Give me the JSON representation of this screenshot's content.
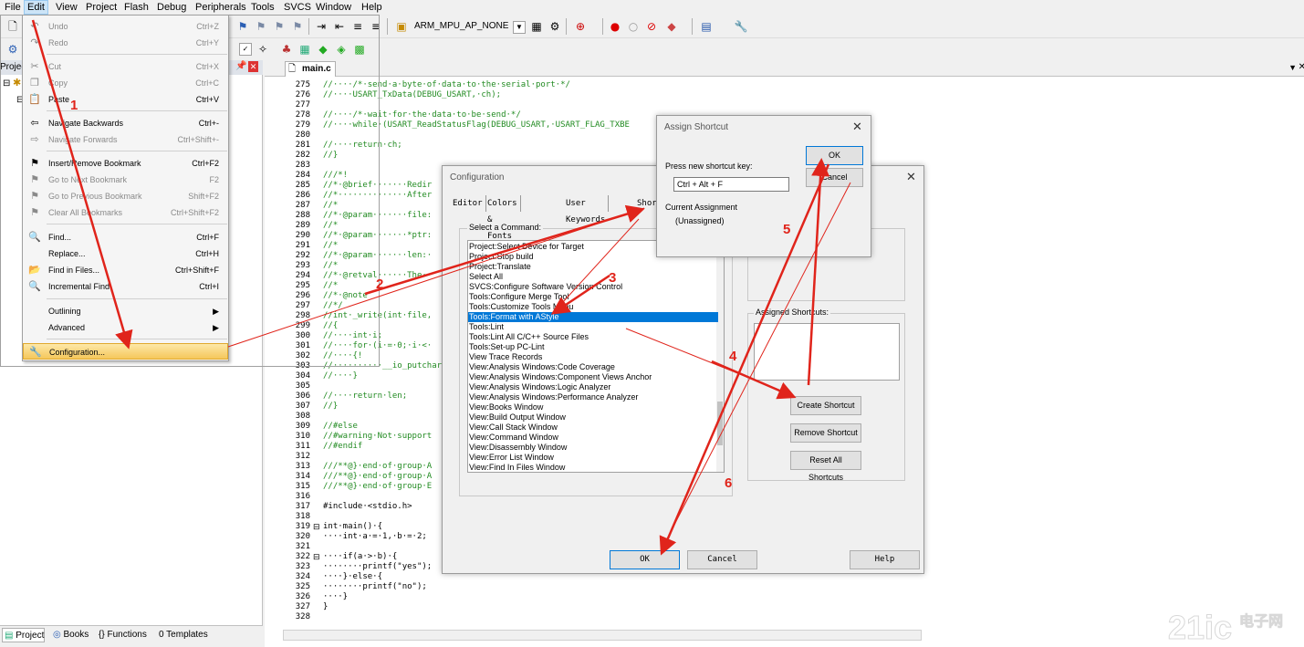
{
  "menubar": {
    "items": [
      "File",
      "Edit",
      "View",
      "Project",
      "Flash",
      "Debug",
      "Peripherals",
      "Tools",
      "SVCS",
      "Window",
      "Help"
    ]
  },
  "toolbar": {
    "mpu_target": "ARM_MPU_AP_NONE"
  },
  "left_panel": {
    "title": "Project"
  },
  "bottom_tabs": [
    "Project",
    "Books",
    "Functions",
    "Templates"
  ],
  "editor": {
    "tab_name": "main.c",
    "lines": [
      {
        "n": "275",
        "t": "//····/*·send·a·byte·of·data·to·the·serial·port·*/",
        "c": true
      },
      {
        "n": "276",
        "t": "//····USART_TxData(DEBUG_USART,·ch);",
        "c": true
      },
      {
        "n": "277",
        "t": "",
        "c": false
      },
      {
        "n": "278",
        "t": "//····/*·wait·for·the·data·to·be·send·*/",
        "c": true
      },
      {
        "n": "279",
        "t": "//····while·(USART_ReadStatusFlag(DEBUG_USART,·USART_FLAG_TXBE",
        "c": true
      },
      {
        "n": "280",
        "t": "",
        "c": false
      },
      {
        "n": "281",
        "t": "//····return·ch;",
        "c": true
      },
      {
        "n": "282",
        "t": "//}",
        "c": true
      },
      {
        "n": "283",
        "t": "",
        "c": false
      },
      {
        "n": "284",
        "t": "///*!",
        "c": true
      },
      {
        "n": "285",
        "t": "//*·@brief·······Redir",
        "c": true
      },
      {
        "n": "286",
        "t": "//*··············After",
        "c": true
      },
      {
        "n": "287",
        "t": "//*",
        "c": true
      },
      {
        "n": "288",
        "t": "//*·@param·······file:",
        "c": true
      },
      {
        "n": "289",
        "t": "//*",
        "c": true
      },
      {
        "n": "290",
        "t": "//*·@param·······*ptr:",
        "c": true
      },
      {
        "n": "291",
        "t": "//*",
        "c": true
      },
      {
        "n": "292",
        "t": "//*·@param·······len:·",
        "c": true
      },
      {
        "n": "293",
        "t": "//*",
        "c": true
      },
      {
        "n": "294",
        "t": "//*·@retval······The·",
        "c": true
      },
      {
        "n": "295",
        "t": "//*",
        "c": true
      },
      {
        "n": "296",
        "t": "//*·@note",
        "c": true
      },
      {
        "n": "297",
        "t": "//*/",
        "c": true
      },
      {
        "n": "298",
        "t": "//int·_write(int·file,",
        "c": true
      },
      {
        "n": "299",
        "t": "//{",
        "c": true
      },
      {
        "n": "300",
        "t": "//····int·i;",
        "c": true
      },
      {
        "n": "301",
        "t": "//····for·(i·=·0;·i·<·",
        "c": true
      },
      {
        "n": "302",
        "t": "//····{!",
        "c": true
      },
      {
        "n": "303",
        "t": "//··········__io_putchar",
        "c": true
      },
      {
        "n": "304",
        "t": "//····}",
        "c": true
      },
      {
        "n": "305",
        "t": "",
        "c": false
      },
      {
        "n": "306",
        "t": "//····return·len;",
        "c": true
      },
      {
        "n": "307",
        "t": "//}",
        "c": true
      },
      {
        "n": "308",
        "t": "",
        "c": false
      },
      {
        "n": "309",
        "t": "//#else",
        "c": true
      },
      {
        "n": "310",
        "t": "//#warning·Not·support",
        "c": true
      },
      {
        "n": "311",
        "t": "//#endif",
        "c": true
      },
      {
        "n": "312",
        "t": "",
        "c": false
      },
      {
        "n": "313",
        "t": "///**@}·end·of·group·A",
        "c": true
      },
      {
        "n": "314",
        "t": "///**@}·end·of·group·A",
        "c": true
      },
      {
        "n": "315",
        "t": "///**@}·end·of·group·E",
        "c": true
      },
      {
        "n": "316",
        "t": "",
        "c": false
      },
      {
        "n": "317",
        "t": "#include·<stdio.h>",
        "c": false
      },
      {
        "n": "318",
        "t": "",
        "c": false
      },
      {
        "n": "319",
        "t": "int·main()·{",
        "c": false
      },
      {
        "n": "320",
        "t": "····int·a·=·1,·b·=·2;",
        "c": false
      },
      {
        "n": "321",
        "t": "",
        "c": false
      },
      {
        "n": "322",
        "t": "····if(a·>·b)·{",
        "c": false
      },
      {
        "n": "323",
        "t": "········printf(\"yes\");",
        "c": false
      },
      {
        "n": "324",
        "t": "····}·else·{",
        "c": false
      },
      {
        "n": "325",
        "t": "········printf(\"no\");",
        "c": false
      },
      {
        "n": "326",
        "t": "····}",
        "c": false
      },
      {
        "n": "327",
        "t": "}",
        "c": false
      },
      {
        "n": "328",
        "t": "",
        "c": false
      }
    ]
  },
  "edit_menu": {
    "items": [
      {
        "label": "Undo",
        "shortcut": "Ctrl+Z",
        "disabled": true,
        "icon": "undo-icon",
        "glyph": "↶"
      },
      {
        "label": "Redo",
        "shortcut": "Ctrl+Y",
        "disabled": true,
        "icon": "redo-icon",
        "glyph": "↷"
      },
      {
        "label": "Cut",
        "shortcut": "Ctrl+X",
        "disabled": true,
        "icon": "cut-icon",
        "glyph": "✂"
      },
      {
        "label": "Copy",
        "shortcut": "Ctrl+C",
        "disabled": true,
        "icon": "copy-icon",
        "glyph": "❐"
      },
      {
        "label": "Paste",
        "shortcut": "Ctrl+V",
        "disabled": false,
        "icon": "paste-icon",
        "glyph": "📋"
      },
      {
        "label": "Navigate Backwards",
        "shortcut": "Ctrl+-",
        "disabled": false,
        "icon": "arrow-left-icon",
        "glyph": "⇦"
      },
      {
        "label": "Navigate Forwards",
        "shortcut": "Ctrl+Shift+-",
        "disabled": true,
        "icon": "arrow-right-icon",
        "glyph": "⇨"
      },
      {
        "label": "Insert/Remove Bookmark",
        "shortcut": "Ctrl+F2",
        "disabled": false,
        "icon": "bookmark-icon",
        "glyph": "⚑"
      },
      {
        "label": "Go to Next Bookmark",
        "shortcut": "F2",
        "disabled": true,
        "icon": "next-bookmark-icon",
        "glyph": "⚑"
      },
      {
        "label": "Go to Previous Bookmark",
        "shortcut": "Shift+F2",
        "disabled": true,
        "icon": "prev-bookmark-icon",
        "glyph": "⚑"
      },
      {
        "label": "Clear All Bookmarks",
        "shortcut": "Ctrl+Shift+F2",
        "disabled": true,
        "icon": "clear-bookmarks-icon",
        "glyph": "⚑"
      },
      {
        "label": "Find...",
        "shortcut": "Ctrl+F",
        "disabled": false,
        "icon": "find-icon",
        "glyph": "🔍"
      },
      {
        "label": "Replace...",
        "shortcut": "Ctrl+H",
        "disabled": false,
        "icon": "",
        "glyph": ""
      },
      {
        "label": "Find in Files...",
        "shortcut": "Ctrl+Shift+F",
        "disabled": false,
        "icon": "find-in-files-icon",
        "glyph": "📂"
      },
      {
        "label": "Incremental Find",
        "shortcut": "Ctrl+I",
        "disabled": false,
        "icon": "incremental-find-icon",
        "glyph": "🔍"
      },
      {
        "label": "Outlining",
        "shortcut": "▶",
        "disabled": false,
        "icon": "",
        "glyph": ""
      },
      {
        "label": "Advanced",
        "shortcut": "▶",
        "disabled": false,
        "icon": "",
        "glyph": ""
      },
      {
        "label": "Configuration...",
        "shortcut": "",
        "disabled": false,
        "icon": "wrench-icon",
        "glyph": "🔧"
      }
    ]
  },
  "config_dialog": {
    "title": "Configuration",
    "tabs": [
      "Editor",
      "Colors & Fonts",
      "User Keywords",
      "Short"
    ],
    "select_label": "Select a Command:",
    "assigned_label": "Assigned Shortcuts:",
    "commands": [
      "Project:Select Device for Target",
      "Project:Stop build",
      "Project:Translate",
      "Select All",
      "SVCS:Configure Software Version Control",
      "Tools:Configure Merge Tool",
      "Tools:Customize Tools Menu",
      "Tools:Format with AStyle",
      "Tools:Lint",
      "Tools:Lint All C/C++ Source Files",
      "Tools:Set-up PC-Lint",
      "View Trace Records",
      "View:Analysis Windows:Code Coverage",
      "View:Analysis Windows:Component Views Anchor",
      "View:Analysis Windows:Logic Analyzer",
      "View:Analysis Windows:Performance Analyzer",
      "View:Books Window",
      "View:Build Output Window",
      "View:Call Stack Window",
      "View:Command Window",
      "View:Disassembly Window",
      "View:Error List Window",
      "View:Find In Files Window"
    ],
    "selected_index": 7,
    "create_shortcut": "Create Shortcut",
    "remove_shortcut": "Remove Shortcut",
    "reset_shortcuts": "Reset All Shortcuts",
    "ok": "OK",
    "cancel": "Cancel",
    "help": "Help"
  },
  "assign_dialog": {
    "title": "Assign Shortcut",
    "prompt": "Press new shortcut key:",
    "key_value": "Ctrl + Alt + F",
    "current_label": "Current Assignment",
    "current_value": "(Unassigned)",
    "ok": "OK",
    "cancel": "Cancel"
  },
  "annotations": [
    "1",
    "2",
    "3",
    "4",
    "5",
    "6"
  ],
  "colors": {
    "annotation_red": "#e0241b",
    "selection_blue": "#0078d7",
    "menu_highlight": "#f5c75b"
  }
}
